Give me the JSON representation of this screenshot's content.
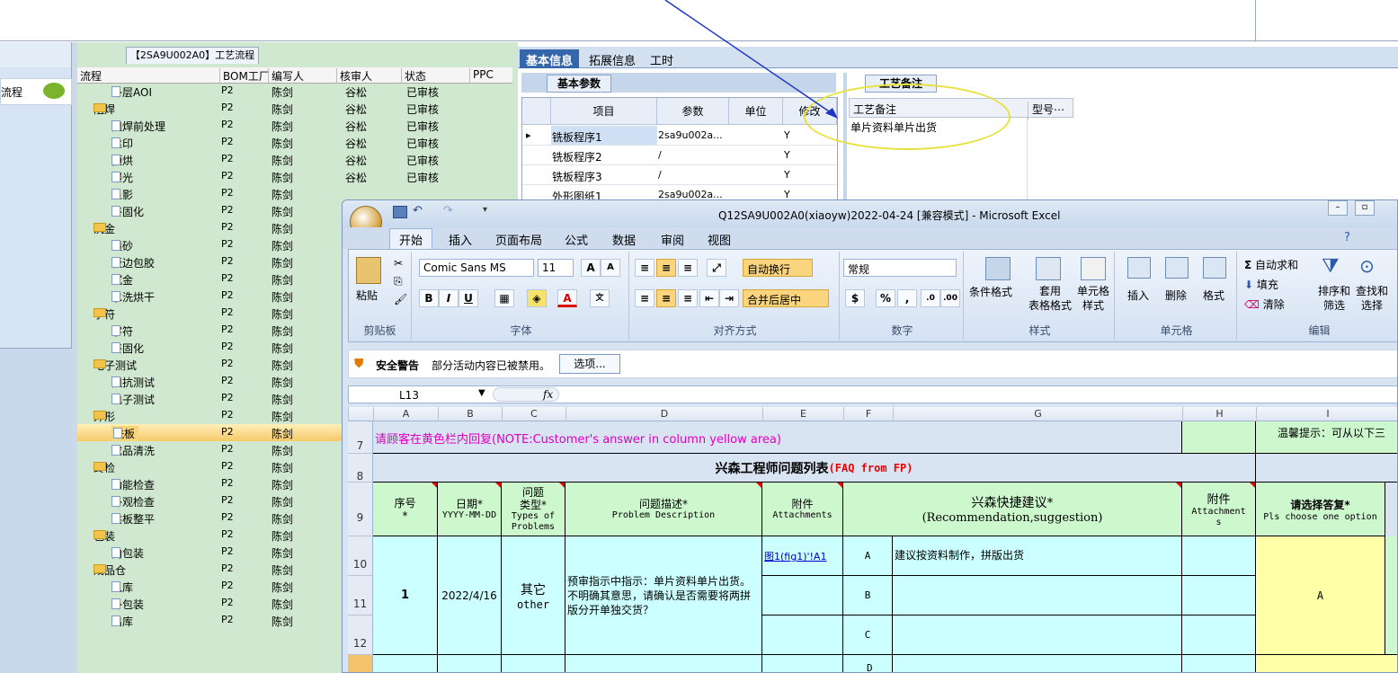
{
  "left_panel": {
    "item": "流程"
  },
  "process": {
    "tab_title": "【2SA9U002A0】工艺流程",
    "headers": [
      "流程",
      "BOM工厂",
      "编写人",
      "核审人",
      "状态",
      "PPC"
    ],
    "rows": [
      {
        "kind": "doc",
        "indent": 2,
        "name": "外层AOI",
        "f": "P2",
        "w": "陈剑",
        "r": "谷松",
        "s": "已审核"
      },
      {
        "kind": "fold",
        "indent": 1,
        "name": "阻焊",
        "f": "P2",
        "w": "陈剑",
        "r": "谷松",
        "s": "已审核"
      },
      {
        "kind": "doc",
        "indent": 2,
        "name": "阻焊前处理",
        "f": "P2",
        "w": "陈剑",
        "r": "谷松",
        "s": "已审核"
      },
      {
        "kind": "doc",
        "indent": 2,
        "name": "丝印",
        "f": "P2",
        "w": "陈剑",
        "r": "谷松",
        "s": "已审核"
      },
      {
        "kind": "doc",
        "indent": 2,
        "name": "预烘",
        "f": "P2",
        "w": "陈剑",
        "r": "谷松",
        "s": "已审核"
      },
      {
        "kind": "doc",
        "indent": 2,
        "name": "曝光",
        "f": "P2",
        "w": "陈剑",
        "r": "谷松",
        "s": "已审核"
      },
      {
        "kind": "doc",
        "indent": 2,
        "name": "显影",
        "f": "P2",
        "w": "陈剑",
        "r": "",
        "s": ""
      },
      {
        "kind": "doc",
        "indent": 2,
        "name": "终固化",
        "f": "P2",
        "w": "陈剑",
        "r": "",
        "s": ""
      },
      {
        "kind": "fold",
        "indent": 1,
        "name": "沉金",
        "f": "P2",
        "w": "陈剑",
        "r": "",
        "s": ""
      },
      {
        "kind": "doc",
        "indent": 2,
        "name": "喷砂",
        "f": "P2",
        "w": "陈剑",
        "r": "",
        "s": ""
      },
      {
        "kind": "doc",
        "indent": 2,
        "name": "板边包胶",
        "f": "P2",
        "w": "陈剑",
        "r": "",
        "s": ""
      },
      {
        "kind": "doc",
        "indent": 2,
        "name": "沉金",
        "f": "P2",
        "w": "陈剑",
        "r": "",
        "s": ""
      },
      {
        "kind": "doc",
        "indent": 2,
        "name": "水洗烘干",
        "f": "P2",
        "w": "陈剑",
        "r": "",
        "s": ""
      },
      {
        "kind": "fold",
        "indent": 1,
        "name": "字符",
        "f": "P2",
        "w": "陈剑",
        "r": "",
        "s": ""
      },
      {
        "kind": "doc",
        "indent": 2,
        "name": "字符",
        "f": "P2",
        "w": "陈剑",
        "r": "",
        "s": ""
      },
      {
        "kind": "doc",
        "indent": 2,
        "name": "终固化",
        "f": "P2",
        "w": "陈剑",
        "r": "",
        "s": ""
      },
      {
        "kind": "fold",
        "indent": 1,
        "name": "电子测试",
        "f": "P2",
        "w": "陈剑",
        "r": "",
        "s": ""
      },
      {
        "kind": "doc",
        "indent": 2,
        "name": "阻抗测试",
        "f": "P2",
        "w": "陈剑",
        "r": "",
        "s": ""
      },
      {
        "kind": "doc",
        "indent": 2,
        "name": "电子测试",
        "f": "P2",
        "w": "陈剑",
        "r": "",
        "s": ""
      },
      {
        "kind": "fold",
        "indent": 1,
        "name": "外形",
        "f": "P2",
        "w": "陈剑",
        "r": "",
        "s": ""
      },
      {
        "kind": "doc",
        "indent": 2,
        "name": "铣板",
        "f": "P2",
        "w": "陈剑",
        "r": "",
        "s": "",
        "selected": true
      },
      {
        "kind": "doc",
        "indent": 2,
        "name": "成品清洗",
        "f": "P2",
        "w": "陈剑",
        "r": "",
        "s": ""
      },
      {
        "kind": "fold",
        "indent": 1,
        "name": "终检",
        "f": "P2",
        "w": "陈剑",
        "r": "",
        "s": ""
      },
      {
        "kind": "doc",
        "indent": 2,
        "name": "功能检查",
        "f": "P2",
        "w": "陈剑",
        "r": "",
        "s": ""
      },
      {
        "kind": "doc",
        "indent": 2,
        "name": "外观检查",
        "f": "P2",
        "w": "陈剑",
        "r": "",
        "s": ""
      },
      {
        "kind": "doc",
        "indent": 2,
        "name": "烘板整平",
        "f": "P2",
        "w": "陈剑",
        "r": "",
        "s": ""
      },
      {
        "kind": "fold",
        "indent": 1,
        "name": "包装",
        "f": "P2",
        "w": "陈剑",
        "r": "",
        "s": ""
      },
      {
        "kind": "doc",
        "indent": 2,
        "name": "内包装",
        "f": "P2",
        "w": "陈剑",
        "r": "",
        "s": ""
      },
      {
        "kind": "fold",
        "indent": 1,
        "name": "成品仓",
        "f": "P2",
        "w": "陈剑",
        "r": "",
        "s": ""
      },
      {
        "kind": "doc",
        "indent": 2,
        "name": "入库",
        "f": "P2",
        "w": "陈剑",
        "r": "",
        "s": ""
      },
      {
        "kind": "doc",
        "indent": 2,
        "name": "外包装",
        "f": "P2",
        "w": "陈剑",
        "r": "",
        "s": ""
      },
      {
        "kind": "doc",
        "indent": 2,
        "name": "出库",
        "f": "P2",
        "w": "陈剑",
        "r": "",
        "s": ""
      }
    ]
  },
  "detail": {
    "tabs": [
      "基本信息",
      "拓展信息",
      "工时"
    ],
    "subtab": "基本参数",
    "headers": [
      "项目",
      "参数",
      "单位",
      "修改"
    ],
    "rows": [
      {
        "item": "铣板程序1",
        "param": "2sa9u002a...",
        "unit": "",
        "mod": "Y"
      },
      {
        "item": "铣板程序2",
        "param": "/",
        "unit": "",
        "mod": "Y"
      },
      {
        "item": "铣板程序3",
        "param": "/",
        "unit": "",
        "mod": "Y"
      },
      {
        "item": "外形图纸1",
        "param": "2sa9u002a...",
        "unit": "",
        "mod": "Y"
      }
    ],
    "note_tab": "工艺备注",
    "note_headers": [
      "工艺备注",
      "型号⋯"
    ],
    "note_value": "单片资料单片出货"
  },
  "excel": {
    "title": "Q12SA9U002A0(xiaoyw)2022-04-24  [兼容模式] - Microsoft Excel",
    "ribbon_tabs": [
      "开始",
      "插入",
      "页面布局",
      "公式",
      "数据",
      "审阅",
      "视图"
    ],
    "groups": {
      "clipboard": {
        "label": "剪贴板",
        "paste": "粘贴"
      },
      "font": {
        "label": "字体",
        "name": "Comic Sans MS",
        "size": "11"
      },
      "align": {
        "label": "对齐方式",
        "wrap": "自动换行",
        "merge": "合并后居中"
      },
      "number": {
        "label": "数字",
        "format": "常规"
      },
      "styles": {
        "label": "样式",
        "cond": "条件格式",
        "table": "套用\n表格格式",
        "cell": "单元格\n样式"
      },
      "cells": {
        "label": "单元格",
        "insert": "插入",
        "delete": "删除",
        "format": "格式"
      },
      "edit": {
        "label": "编辑",
        "sum": "自动求和",
        "fill": "填充",
        "clear": "清除",
        "sort": "排序和\n筛选",
        "find": "查找和\n选择"
      }
    },
    "security": {
      "title": "安全警告",
      "msg": "部分活动内容已被禁用。",
      "btn": "选项..."
    },
    "namebox": "L13",
    "fx": "fx",
    "columns": [
      "A",
      "B",
      "C",
      "D",
      "E",
      "F",
      "G",
      "H",
      "I"
    ],
    "row_nums": [
      "7",
      "8",
      "9",
      "10",
      "11",
      "12"
    ],
    "sheet": {
      "r7_note": "请顾客在黄色栏内回复(NOTE:Customer's answer in column yellow area)",
      "r7_tip": "温馨提示：可从以下三",
      "r8_title": "兴森工程师问题列表",
      "r8_title_en": "(FAQ from FP)",
      "h_seq": "序号\n*",
      "h_date": "日期*",
      "h_date_fmt": "YYYY-MM-DD",
      "h_type": "问题\n类型*",
      "h_type_en": "Types of\nProblems",
      "h_desc": "问题描述*",
      "h_desc_en": "Problem Description",
      "h_att": "附件",
      "h_att_en": "Attachments",
      "h_rec": "兴森快捷建议*",
      "h_rec_en": "(Recommendation,suggestion)",
      "h_att2": "附件",
      "h_att2_en": "Attachment\ns",
      "h_ans": "请选择答复*",
      "h_ans_en": "Pls choose one option",
      "seq": "1",
      "date": "2022/4/16",
      "type": "其它",
      "type_en": "other",
      "desc": "预审指示中指示：单片资料单片出货。不明确其意思，请确认是否需要将两拼版分开单独交货？",
      "att_link": "图1(fig1)'!A1",
      "opt_a": "A",
      "opt_b": "B",
      "opt_c": "C",
      "opt_d": "D",
      "rec_a": "建议按资料制作，拼版出货",
      "answer": "A"
    }
  }
}
